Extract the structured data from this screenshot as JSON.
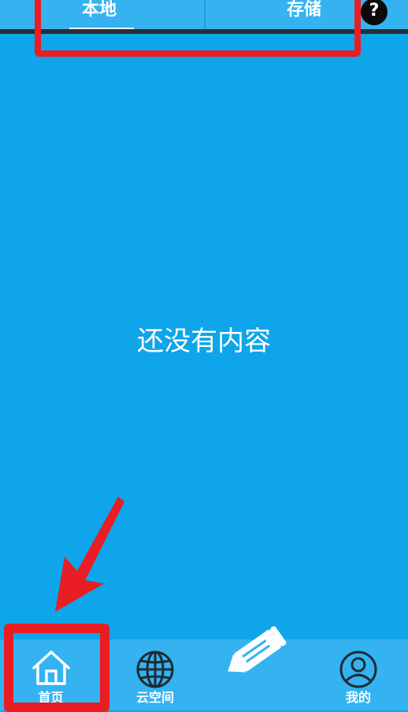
{
  "top_tabs": {
    "local_label": "本地",
    "storage_label": "存储",
    "help_label": "?"
  },
  "content": {
    "empty_message": "还没有内容"
  },
  "bottom_nav": {
    "items": [
      {
        "label": "首页",
        "icon": "home-icon"
      },
      {
        "label": "云空间",
        "icon": "globe-icon"
      },
      {
        "label": "",
        "icon": "pencil-icon"
      },
      {
        "label": "我的",
        "icon": "user-icon"
      }
    ]
  },
  "colors": {
    "background": "#0ea5ea",
    "bar": "#34b3f0",
    "annotation_red": "#ea1c24"
  }
}
